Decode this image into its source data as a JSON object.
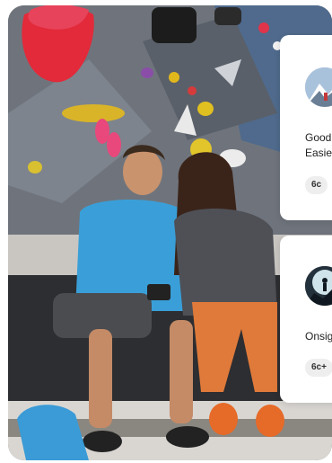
{
  "photo": {
    "description_icon": "climbing-gym-photo"
  },
  "cards": [
    {
      "title": "Good\nEasie",
      "grade": "6c",
      "avatar_icon": "mountain-avatar-icon"
    },
    {
      "title": "Onsig",
      "grade": "6c+",
      "avatar_icon": "climber-silhouette-avatar-icon"
    }
  ],
  "colors": {
    "card_bg": "#ffffff",
    "grade_bg": "#eeeeee",
    "text": "#222222"
  }
}
